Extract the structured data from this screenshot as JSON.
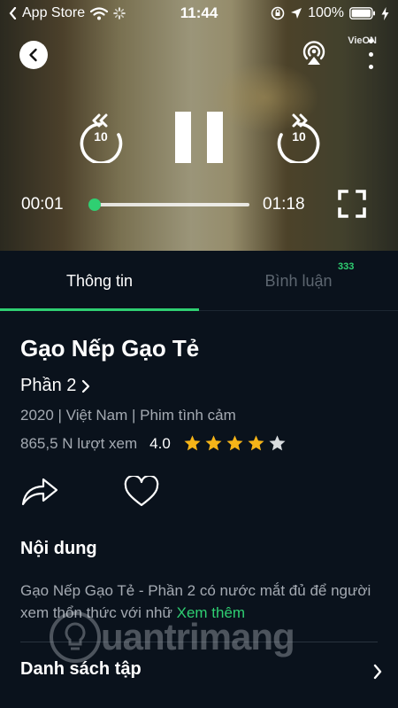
{
  "status_bar": {
    "carrier": "App Store",
    "time": "11:44",
    "battery": "100%"
  },
  "player": {
    "brand": "VieON",
    "current_time": "00:01",
    "total_time": "01:18",
    "rewind_seconds": "10",
    "forward_seconds": "10",
    "progress": 0.013
  },
  "tabs": [
    {
      "label": "Thông tin",
      "active": true
    },
    {
      "label": "Bình luận",
      "badge": "333",
      "active": false
    }
  ],
  "details": {
    "title": "Gạo Nếp Gạo Tẻ",
    "season": "Phần 2",
    "meta": "2020 | Việt Nam | Phim tình cảm",
    "views": "865,5 N lượt xem",
    "rating": "4.0",
    "stars_filled": 4,
    "stars_total": 5,
    "section_title": "Nội dung",
    "description": "Gạo Nếp Gạo Tẻ - Phần 2 có nước mắt đủ để người xem thổn thức với nhữ",
    "read_more": "Xem thêm",
    "episodes_title": "Danh sách tập"
  },
  "watermark": "uantrimang",
  "colors": {
    "accent": "#2fcf72",
    "background": "#0a121c",
    "star_filled": "#f5b418",
    "star_empty": "#d8dcdf"
  }
}
